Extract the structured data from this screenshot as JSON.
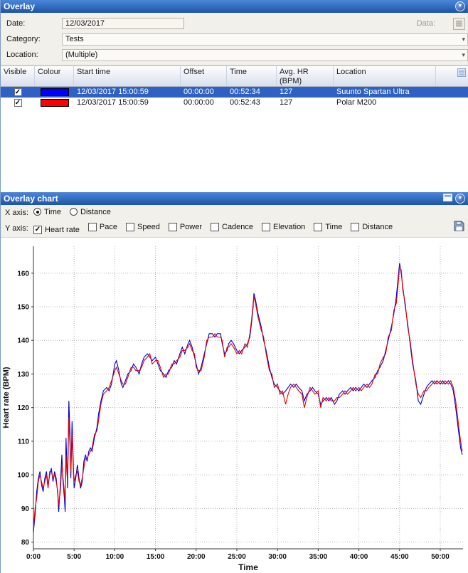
{
  "window": {
    "title": "Overlay"
  },
  "icons": {
    "collapse_glyph": "▼",
    "dropdown_glyph": "▾",
    "check_glyph": "✓",
    "data_button_glyph": "▦"
  },
  "form": {
    "date_label": "Date:",
    "date_value": "12/03/2017",
    "data_label": "Data:",
    "category_label": "Category:",
    "category_value": "Tests",
    "location_label": "Location:",
    "location_value": "(Multiple)"
  },
  "table": {
    "columns": [
      "Visible",
      "Colour",
      "Start time",
      "Offset",
      "Time",
      "Avg. HR (BPM)",
      "Location"
    ],
    "rows": [
      {
        "visible": true,
        "colour": "#0000ff",
        "start_time": "12/03/2017 15:00:59",
        "offset": "00:00:00",
        "time": "00:52:34",
        "avg_hr": "127",
        "location": "Suunto Spartan Ultra",
        "selected": true
      },
      {
        "visible": true,
        "colour": "#ff0000",
        "start_time": "12/03/2017 15:00:59",
        "offset": "00:00:00",
        "time": "00:52:43",
        "avg_hr": "127",
        "location": "Polar M200",
        "selected": false
      }
    ]
  },
  "chart_panel": {
    "title": "Overlay chart",
    "x_axis_label": "X axis:",
    "y_axis_label": "Y axis:",
    "x_options": [
      {
        "label": "Time",
        "selected": true
      },
      {
        "label": "Distance",
        "selected": false
      }
    ],
    "y_options": [
      {
        "label": "Heart rate",
        "checked": true
      },
      {
        "label": "Pace",
        "checked": false
      },
      {
        "label": "Speed",
        "checked": false
      },
      {
        "label": "Power",
        "checked": false
      },
      {
        "label": "Cadence",
        "checked": false
      },
      {
        "label": "Elevation",
        "checked": false
      },
      {
        "label": "Time",
        "checked": false
      },
      {
        "label": "Distance",
        "checked": false
      }
    ]
  },
  "chart_data": {
    "type": "line",
    "title": "",
    "xlabel": "Time",
    "ylabel": "Heart rate (BPM)",
    "xlim": [
      0,
      52.8
    ],
    "ylim": [
      78,
      168
    ],
    "y_ticks": [
      80,
      90,
      100,
      110,
      120,
      130,
      140,
      150,
      160
    ],
    "x_ticks": [
      "0:00",
      "5:00",
      "10:00",
      "15:00",
      "20:00",
      "25:00",
      "30:00",
      "35:00",
      "40:00",
      "45:00",
      "50:00"
    ],
    "x_tick_minutes": [
      0,
      5,
      10,
      15,
      20,
      25,
      30,
      35,
      40,
      45,
      50
    ],
    "grid": true,
    "legend": "none",
    "x": [
      0,
      0.2,
      0.4,
      0.6,
      0.8,
      1.0,
      1.2,
      1.4,
      1.6,
      1.8,
      2.0,
      2.2,
      2.4,
      2.6,
      2.8,
      3.0,
      3.1,
      3.3,
      3.5,
      3.6,
      3.8,
      3.9,
      4.0,
      4.1,
      4.2,
      4.35,
      4.5,
      4.6,
      4.75,
      4.9,
      5.0,
      5.2,
      5.4,
      5.6,
      5.8,
      6.0,
      6.2,
      6.4,
      6.6,
      6.8,
      7.0,
      7.2,
      7.5,
      7.8,
      8.0,
      8.3,
      8.6,
      9.0,
      9.3,
      9.6,
      10.0,
      10.2,
      10.5,
      10.8,
      11.0,
      11.3,
      11.6,
      12.0,
      12.3,
      12.6,
      13.0,
      13.3,
      13.6,
      14.0,
      14.3,
      14.6,
      15.0,
      15.3,
      15.6,
      16.0,
      16.3,
      16.6,
      17.0,
      17.3,
      17.6,
      18.0,
      18.3,
      18.6,
      19.0,
      19.2,
      19.5,
      19.8,
      20.0,
      20.3,
      20.6,
      21.0,
      21.3,
      21.6,
      22.0,
      22.3,
      22.6,
      23.0,
      23.2,
      23.5,
      23.8,
      24.0,
      24.3,
      24.6,
      25.0,
      25.3,
      25.6,
      26.0,
      26.3,
      26.6,
      26.8,
      27.0,
      27.1,
      27.3,
      27.6,
      28.0,
      28.3,
      28.6,
      29.0,
      29.3,
      29.6,
      30.0,
      30.3,
      30.6,
      31.0,
      31.3,
      31.6,
      32.0,
      32.3,
      32.6,
      33.0,
      33.3,
      33.6,
      34.0,
      34.3,
      34.6,
      35.0,
      35.3,
      35.6,
      36.0,
      36.3,
      36.6,
      37.0,
      37.3,
      37.6,
      38.0,
      38.3,
      38.6,
      39.0,
      39.3,
      39.6,
      40.0,
      40.3,
      40.6,
      41.0,
      41.3,
      41.6,
      42.0,
      42.3,
      42.6,
      43.0,
      43.3,
      43.6,
      44.0,
      44.3,
      44.6,
      44.8,
      45.0,
      45.2,
      45.4,
      45.7,
      46.0,
      46.3,
      46.6,
      47.0,
      47.3,
      47.6,
      48.0,
      48.3,
      48.6,
      49.0,
      49.3,
      49.6,
      50.0,
      50.3,
      50.6,
      51.0,
      51.3,
      51.6,
      51.9,
      52.2,
      52.5,
      52.7
    ],
    "series": [
      {
        "name": "Suunto Spartan Ultra",
        "color": "#0000d0",
        "y": [
          83,
          88,
          95,
          99,
          101,
          97,
          95,
          99,
          101,
          97,
          100,
          102,
          98,
          101,
          99,
          94,
          89,
          97,
          106,
          99,
          93,
          89,
          111,
          104,
          96,
          122,
          112,
          99,
          116,
          103,
          96,
          99,
          103,
          99,
          96,
          98,
          104,
          106,
          104,
          107,
          108,
          107,
          111,
          114,
          118,
          122,
          125,
          126,
          125,
          127,
          133,
          134,
          131,
          127,
          126,
          128,
          130,
          131,
          133,
          132,
          130,
          133,
          135,
          136,
          135,
          134,
          135,
          133,
          131,
          130,
          129,
          131,
          132,
          134,
          133,
          136,
          138,
          136,
          139,
          140,
          138,
          135,
          133,
          130,
          132,
          136,
          139,
          142,
          142,
          141,
          142,
          142,
          139,
          136,
          137,
          139,
          140,
          139,
          137,
          136,
          137,
          138,
          139,
          141,
          145,
          150,
          154,
          152,
          148,
          144,
          140,
          137,
          132,
          129,
          127,
          126,
          125,
          124,
          125,
          126,
          127,
          126,
          127,
          126,
          125,
          122,
          124,
          125,
          126,
          125,
          124,
          121,
          122,
          123,
          122,
          123,
          121,
          122,
          124,
          125,
          124,
          125,
          126,
          125,
          126,
          125,
          126,
          127,
          126,
          127,
          128,
          129,
          131,
          132,
          134,
          137,
          140,
          144,
          148,
          153,
          158,
          163,
          160,
          156,
          150,
          145,
          139,
          133,
          128,
          122,
          121,
          124,
          126,
          127,
          128,
          127,
          128,
          127,
          128,
          127,
          128,
          127,
          125,
          120,
          114,
          108,
          106
        ]
      },
      {
        "name": "Polar M200",
        "color": "#e00000",
        "y": [
          84,
          90,
          93,
          98,
          100,
          98,
          96,
          98,
          100,
          96,
          101,
          101,
          99,
          100,
          98,
          95,
          91,
          95,
          103,
          100,
          95,
          92,
          106,
          101,
          98,
          117,
          108,
          101,
          112,
          101,
          98,
          100,
          101,
          98,
          97,
          99,
          102,
          105,
          105,
          106,
          107,
          108,
          112,
          113,
          116,
          121,
          124,
          125,
          126,
          128,
          131,
          132,
          130,
          128,
          127,
          127,
          129,
          132,
          132,
          131,
          131,
          132,
          134,
          135,
          136,
          133,
          134,
          134,
          132,
          129,
          130,
          130,
          133,
          133,
          134,
          135,
          137,
          137,
          138,
          139,
          137,
          136,
          132,
          131,
          131,
          135,
          140,
          141,
          141,
          142,
          141,
          141,
          140,
          135,
          138,
          138,
          139,
          138,
          136,
          137,
          136,
          139,
          138,
          142,
          146,
          151,
          153,
          151,
          147,
          143,
          141,
          136,
          131,
          130,
          126,
          127,
          124,
          125,
          121,
          124,
          126,
          127,
          126,
          125,
          124,
          120,
          123,
          126,
          125,
          124,
          125,
          120,
          123,
          122,
          123,
          122,
          122,
          123,
          123,
          124,
          125,
          124,
          125,
          126,
          125,
          126,
          125,
          126,
          127,
          126,
          127,
          130,
          130,
          133,
          135,
          136,
          141,
          143,
          149,
          151,
          156,
          162,
          161,
          155,
          151,
          144,
          140,
          134,
          127,
          124,
          123,
          125,
          125,
          126,
          127,
          128,
          127,
          128,
          127,
          128,
          127,
          128,
          126,
          122,
          116,
          110,
          107
        ]
      }
    ]
  }
}
